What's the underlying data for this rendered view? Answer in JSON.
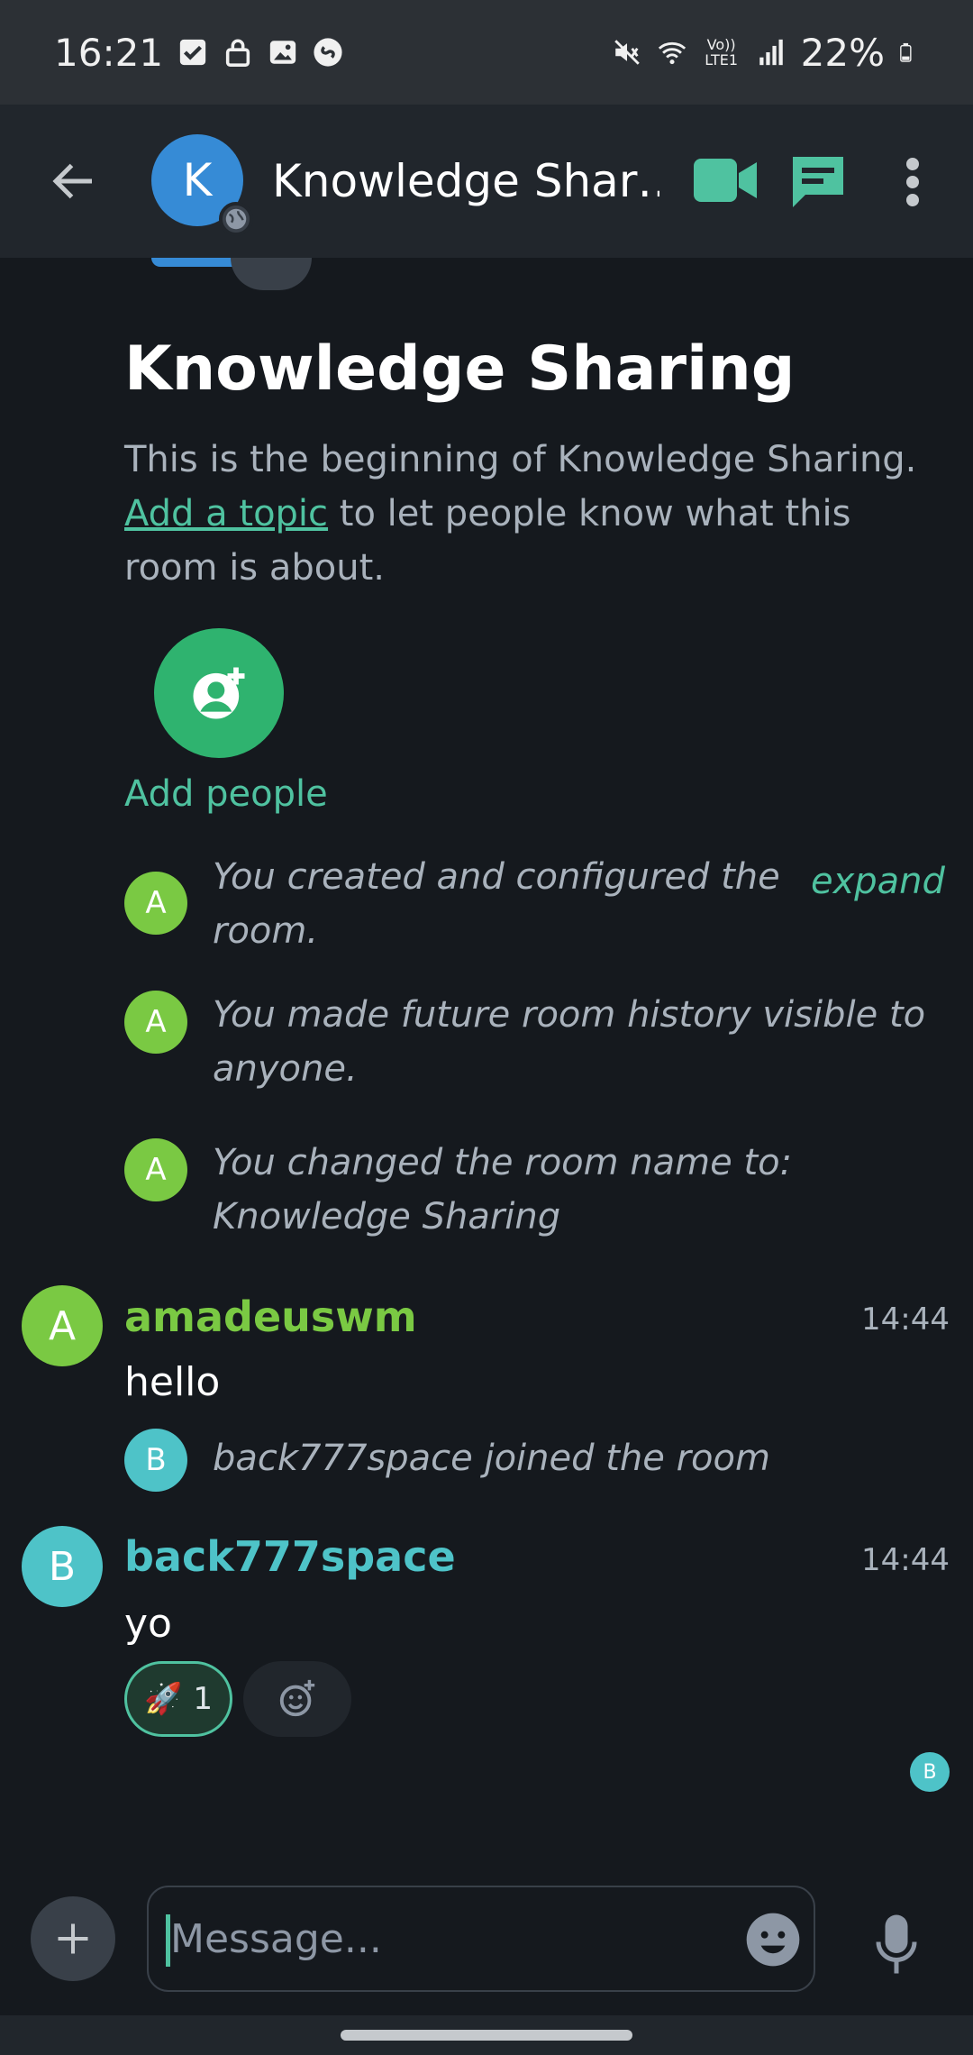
{
  "status_bar": {
    "time": "16:21",
    "battery": "22%",
    "icons_left": [
      "checkbox-icon",
      "lock-icon",
      "gallery-icon",
      "shazam-icon"
    ],
    "icons_right": [
      "mute-icon",
      "wifi-icon",
      "volte-icon",
      "signal-icon",
      "battery-icon"
    ],
    "volte_text": "Vo)) LTE1"
  },
  "header": {
    "avatar_letter": "K",
    "room_name": "Knowledge Shar…",
    "accent_color": "#4fc2a0"
  },
  "intro": {
    "title": "Knowledge Sharing",
    "line1": "This is the beginning of Knowledge Sharing.",
    "topic_link": "Add a topic",
    "line2_rest": " to let people know what this room is about.",
    "add_people_label": "Add people"
  },
  "events": [
    {
      "avatar": "A",
      "text_line1": "You created and configured the",
      "text_line2": "room.",
      "expand": "expand"
    },
    {
      "avatar": "A",
      "text_line1": "You made future room history visible to",
      "text_line2": "anyone."
    },
    {
      "avatar": "A",
      "text_line1": "You changed the room name to:",
      "text_line2": "Knowledge Sharing"
    }
  ],
  "messages": [
    {
      "avatar": "A",
      "sender": "amadeuswm",
      "time": "14:44",
      "body": "hello",
      "color": "#7ac943"
    },
    {
      "avatar": "B",
      "sender": "back777space",
      "time": "14:44",
      "body": "yo",
      "color": "#4ec3c8"
    }
  ],
  "join_event": {
    "avatar": "B",
    "text": "back777space joined the room"
  },
  "reaction": {
    "emoji": "🚀",
    "count": "1"
  },
  "read_receipt": "B",
  "composer": {
    "placeholder": "Message..."
  }
}
